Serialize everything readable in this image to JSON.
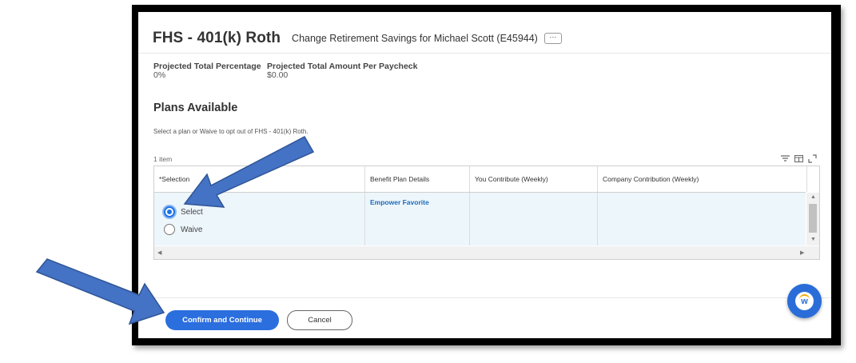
{
  "header": {
    "title": "FHS - 401(k) Roth",
    "subtitle": "Change Retirement Savings for Michael Scott (E45944)",
    "more_label": "⋯"
  },
  "stats": [
    {
      "label": "Projected Total Percentage",
      "value": "0%"
    },
    {
      "label": "Projected Total Amount Per Paycheck",
      "value": "$0.00"
    }
  ],
  "plans": {
    "title": "Plans Available",
    "instruction": "Select a plan or Waive to opt out of FHS - 401(k) Roth.",
    "count": "1 item",
    "columns": [
      "*Selection",
      "Benefit Plan Details",
      "You Contribute (Weekly)",
      "Company Contribution (Weekly)"
    ],
    "row": {
      "plan_name": "Empower Favorite",
      "options": [
        {
          "label": "Select",
          "selected": true
        },
        {
          "label": "Waive",
          "selected": false
        }
      ]
    }
  },
  "footer": {
    "confirm_label": "Confirm and Continue",
    "cancel_label": "Cancel"
  },
  "icons": [
    "filter-icon",
    "table-view-icon",
    "fullscreen-icon",
    "chat-assistant-icon"
  ],
  "colors": {
    "accent": "#2b6ede",
    "arrow": "#4472c4",
    "row_highlight": "#edf6fb",
    "link": "#1d6bb8"
  }
}
